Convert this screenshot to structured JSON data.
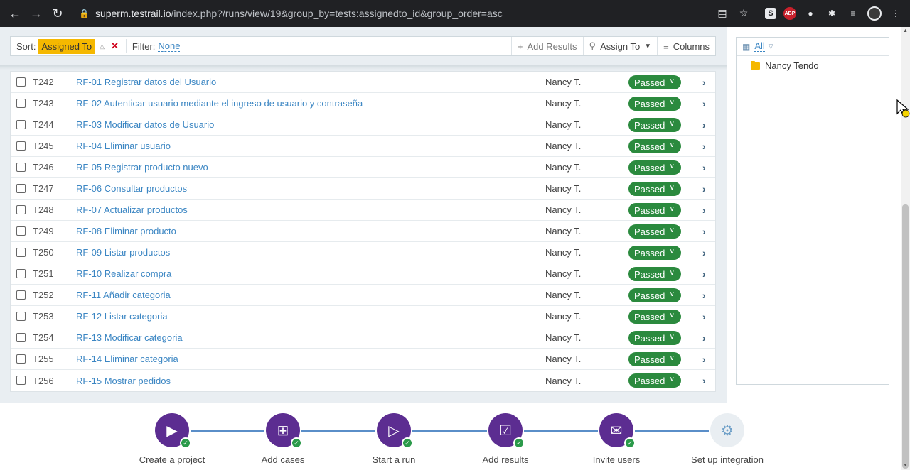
{
  "browser": {
    "url_host": "superm.testrail.io",
    "url_path": "/index.php?/runs/view/19&group_by=tests:assignedto_id&group_order=asc"
  },
  "toolbar": {
    "sort_label": "Sort:",
    "sort_value": "Assigned To",
    "filter_label": "Filter:",
    "filter_value": "None",
    "add_results": "Add Results",
    "assign_to": "Assign To",
    "columns": "Columns"
  },
  "tests": [
    {
      "id": "T242",
      "title": "RF-01 Registrar datos del Usuario",
      "assignee": "Nancy T.",
      "status": "Passed"
    },
    {
      "id": "T243",
      "title": "RF-02 Autenticar usuario mediante el ingreso de usuario y contraseña",
      "assignee": "Nancy T.",
      "status": "Passed"
    },
    {
      "id": "T244",
      "title": "RF-03 Modificar datos de Usuario",
      "assignee": "Nancy T.",
      "status": "Passed"
    },
    {
      "id": "T245",
      "title": "RF-04 Eliminar usuario",
      "assignee": "Nancy T.",
      "status": "Passed"
    },
    {
      "id": "T246",
      "title": "RF-05 Registrar producto nuevo",
      "assignee": "Nancy T.",
      "status": "Passed"
    },
    {
      "id": "T247",
      "title": "RF-06 Consultar productos",
      "assignee": "Nancy T.",
      "status": "Passed"
    },
    {
      "id": "T248",
      "title": "RF-07 Actualizar productos",
      "assignee": "Nancy T.",
      "status": "Passed"
    },
    {
      "id": "T249",
      "title": "RF-08 Eliminar producto",
      "assignee": "Nancy T.",
      "status": "Passed"
    },
    {
      "id": "T250",
      "title": "RF-09 Listar productos",
      "assignee": "Nancy T.",
      "status": "Passed"
    },
    {
      "id": "T251",
      "title": "RF-10 Realizar compra",
      "assignee": "Nancy T.",
      "status": "Passed"
    },
    {
      "id": "T252",
      "title": "RF-11 Añadir categoria",
      "assignee": "Nancy T.",
      "status": "Passed"
    },
    {
      "id": "T253",
      "title": "RF-12 Listar categoria",
      "assignee": "Nancy T.",
      "status": "Passed"
    },
    {
      "id": "T254",
      "title": "RF-13 Modificar categoria",
      "assignee": "Nancy T.",
      "status": "Passed"
    },
    {
      "id": "T255",
      "title": "RF-14 Eliminar categoria",
      "assignee": "Nancy T.",
      "status": "Passed"
    },
    {
      "id": "T256",
      "title": "RF-15 Mostrar pedidos",
      "assignee": "Nancy T.",
      "status": "Passed"
    }
  ],
  "sidebar": {
    "filter_all": "All",
    "groups": [
      "Nancy Tendo"
    ]
  },
  "steps": [
    {
      "label": "Create a project",
      "icon": "play-sparkle-icon",
      "done": true
    },
    {
      "label": "Add cases",
      "icon": "folder-add-icon",
      "done": true
    },
    {
      "label": "Start a run",
      "icon": "clipboard-play-icon",
      "done": true
    },
    {
      "label": "Add results",
      "icon": "checklist-icon",
      "done": true
    },
    {
      "label": "Invite users",
      "icon": "user-mail-icon",
      "done": true
    },
    {
      "label": "Set up integration",
      "icon": "gears-icon",
      "done": false
    }
  ],
  "colors": {
    "accent": "#5c2d91",
    "passed": "#2b8a3e",
    "link": "#3b86c3",
    "sort_tag": "#f5b800"
  }
}
